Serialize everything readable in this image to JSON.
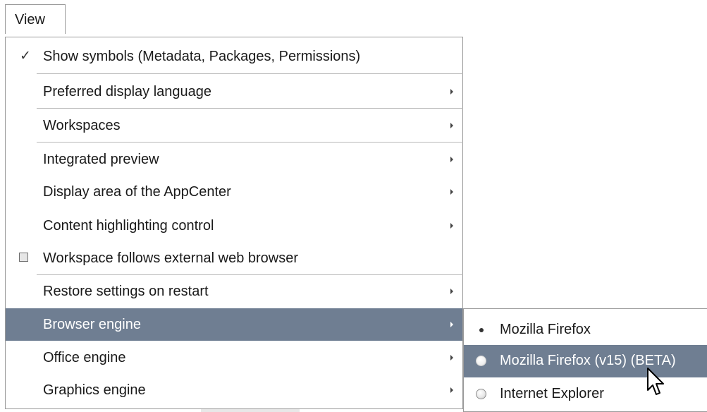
{
  "menubar": {
    "view_label": "View"
  },
  "menu": {
    "items": [
      {
        "label": "Show symbols (Metadata, Packages, Permissions)"
      },
      {
        "label": "Preferred display language"
      },
      {
        "label": "Workspaces"
      },
      {
        "label": "Integrated preview"
      },
      {
        "label": "Display area of the AppCenter"
      },
      {
        "label": "Content highlighting control"
      },
      {
        "label": "Workspace follows external web browser"
      },
      {
        "label": "Restore settings on restart"
      },
      {
        "label": "Browser engine"
      },
      {
        "label": "Office engine"
      },
      {
        "label": "Graphics engine"
      }
    ]
  },
  "submenu": {
    "items": [
      {
        "label": "Mozilla Firefox"
      },
      {
        "label": "Mozilla Firefox (v15) (BETA)"
      },
      {
        "label": "Internet Explorer"
      }
    ]
  },
  "icons": {
    "check": "checkmark-icon",
    "checkbox": "checkbox-unchecked",
    "submenu_arrow": "triangle-right-icon",
    "radio": "radio-icon",
    "cursor": "mouse-pointer"
  },
  "colors": {
    "highlight": "#6f7e92",
    "border": "#9a9a9a",
    "separator": "#b8b8b8"
  }
}
